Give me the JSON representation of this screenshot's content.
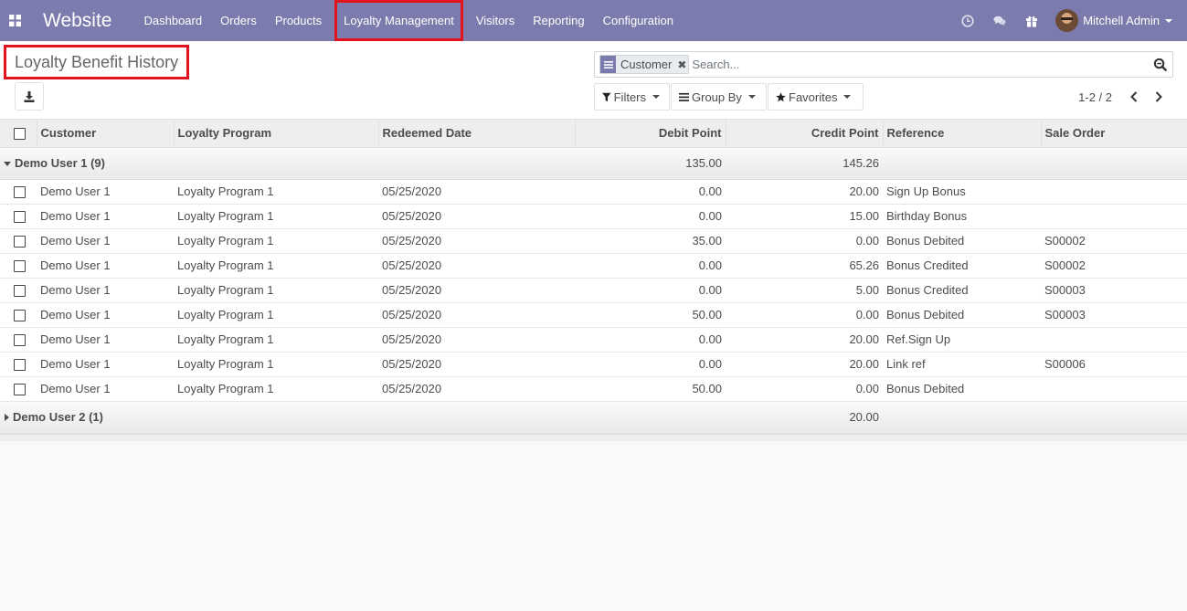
{
  "navbar": {
    "brand": "Website",
    "menu": [
      "Dashboard",
      "Orders",
      "Products",
      "Loyalty Management",
      "Visitors",
      "Reporting",
      "Configuration"
    ],
    "user_name": "Mitchell Admin",
    "accent_color": "#7c7bad"
  },
  "control_panel": {
    "title": "Loyalty Benefit History",
    "search": {
      "facet_label": "Customer",
      "placeholder": "Search..."
    },
    "filters_label": "Filters",
    "group_by_label": "Group By",
    "favorites_label": "Favorites",
    "pager": "1-2 / 2"
  },
  "table": {
    "columns": [
      "Customer",
      "Loyalty Program",
      "Redeemed Date",
      "Debit Point",
      "Credit Point",
      "Reference",
      "Sale Order"
    ],
    "groups": [
      {
        "label": "Demo User 1 (9)",
        "expanded": true,
        "debit_total": "135.00",
        "credit_total": "145.26",
        "rows": [
          [
            "Demo User 1",
            "Loyalty Program 1",
            "05/25/2020",
            "0.00",
            "20.00",
            "Sign Up Bonus",
            ""
          ],
          [
            "Demo User 1",
            "Loyalty Program 1",
            "05/25/2020",
            "0.00",
            "15.00",
            "Birthday Bonus",
            ""
          ],
          [
            "Demo User 1",
            "Loyalty Program 1",
            "05/25/2020",
            "35.00",
            "0.00",
            "Bonus Debited",
            "S00002"
          ],
          [
            "Demo User 1",
            "Loyalty Program 1",
            "05/25/2020",
            "0.00",
            "65.26",
            "Bonus Credited",
            "S00002"
          ],
          [
            "Demo User 1",
            "Loyalty Program 1",
            "05/25/2020",
            "0.00",
            "5.00",
            "Bonus Credited",
            "S00003"
          ],
          [
            "Demo User 1",
            "Loyalty Program 1",
            "05/25/2020",
            "50.00",
            "0.00",
            "Bonus Debited",
            "S00003"
          ],
          [
            "Demo User 1",
            "Loyalty Program 1",
            "05/25/2020",
            "0.00",
            "20.00",
            "Ref.Sign Up",
            ""
          ],
          [
            "Demo User 1",
            "Loyalty Program 1",
            "05/25/2020",
            "0.00",
            "20.00",
            "Link ref",
            "S00006"
          ],
          [
            "Demo User 1",
            "Loyalty Program 1",
            "05/25/2020",
            "50.00",
            "0.00",
            "Bonus Debited",
            ""
          ]
        ]
      },
      {
        "label": "Demo User 2 (1)",
        "expanded": false,
        "debit_total": "",
        "credit_total": "20.00",
        "rows": []
      }
    ]
  }
}
